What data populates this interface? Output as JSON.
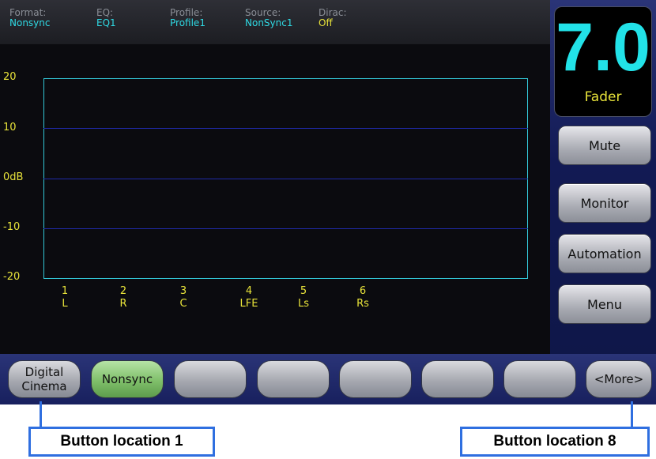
{
  "header": {
    "fields": [
      {
        "label": "Format:",
        "value": "Nonsync"
      },
      {
        "label": "EQ:",
        "value": "EQ1"
      },
      {
        "label": "Profile:",
        "value": "Profile1"
      },
      {
        "label": "Source:",
        "value": "NonSync1"
      },
      {
        "label": "Dirac:",
        "value": "Off"
      }
    ]
  },
  "graph": {
    "y_labels": [
      "20",
      "10",
      "0dB",
      "-10",
      "-20"
    ],
    "channels": [
      {
        "num": "1",
        "name": "L"
      },
      {
        "num": "2",
        "name": "R"
      },
      {
        "num": "3",
        "name": "C"
      },
      {
        "num": "4",
        "name": "LFE"
      },
      {
        "num": "5",
        "name": "Ls"
      },
      {
        "num": "6",
        "name": "Rs"
      }
    ]
  },
  "fader": {
    "value": "7.0",
    "label": "Fader"
  },
  "side_buttons": [
    "Mute",
    "Monitor",
    "Automation",
    "Menu"
  ],
  "softkeys": [
    {
      "label": "Digital Cinema",
      "active": false
    },
    {
      "label": "Nonsync",
      "active": true
    },
    {
      "label": "",
      "active": false
    },
    {
      "label": "",
      "active": false
    },
    {
      "label": "",
      "active": false
    },
    {
      "label": "",
      "active": false
    },
    {
      "label": "",
      "active": false
    },
    {
      "label": "<More>",
      "active": false
    }
  ],
  "callouts": {
    "left": "Button location 1",
    "right": "Button location 8"
  },
  "colors": {
    "accent_cyan": "#2fd9e3",
    "accent_yellow": "#e8e33a",
    "grid_blue": "#1f2aa8",
    "active_green": "#7fbf6a",
    "callout_blue": "#2f6fe0"
  }
}
